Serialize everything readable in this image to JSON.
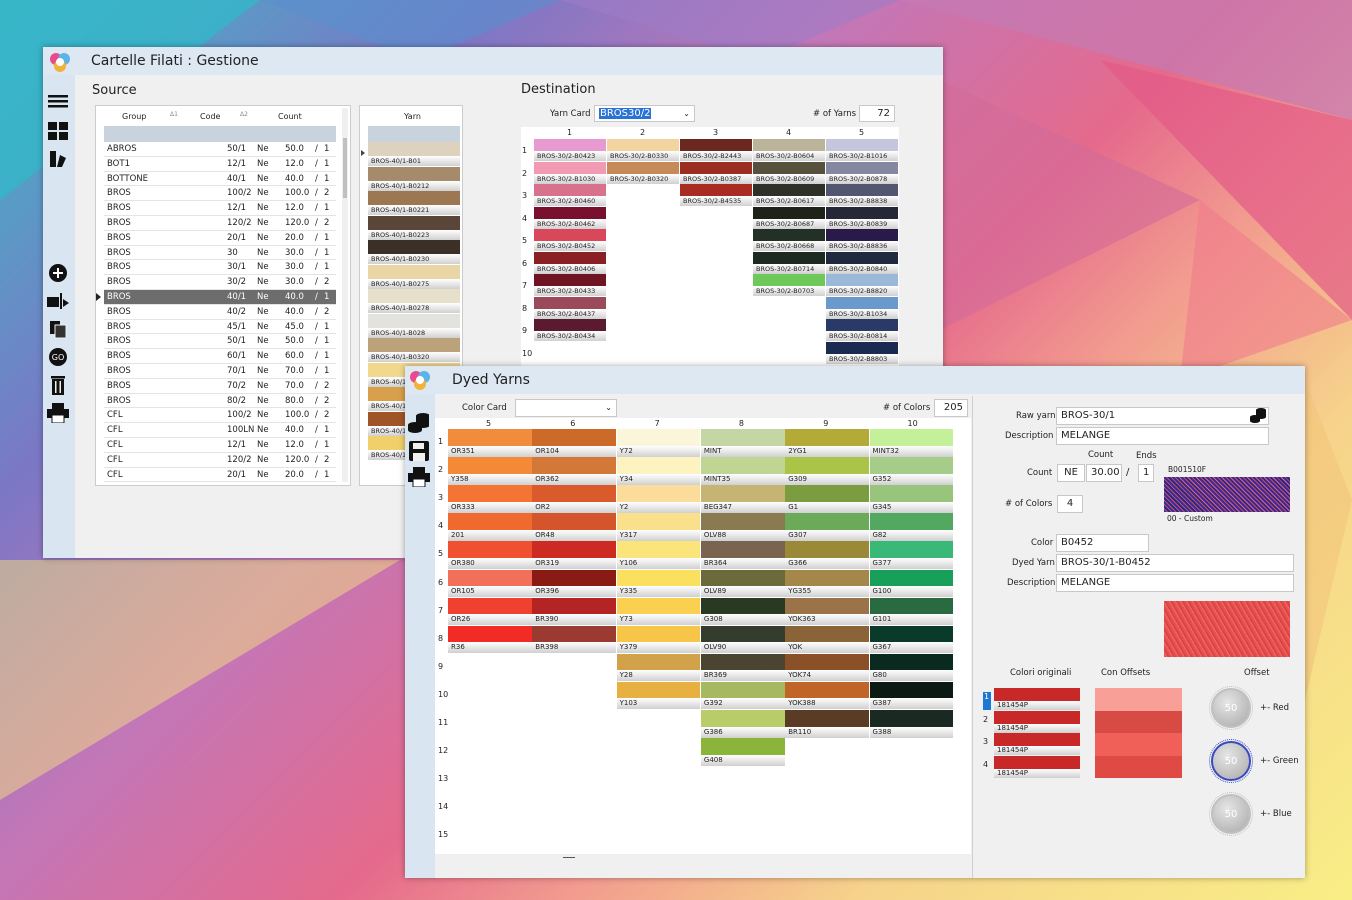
{
  "cartelle": {
    "title": "Cartelle Filati : Gestione",
    "source_label": "Source",
    "destination_label": "Destination",
    "source_headers": {
      "group": "Group",
      "code": "Code",
      "count": "Count",
      "yarn": "Yarn",
      "sort1": "Δ1",
      "sort2": "Δ2"
    },
    "source_rows": [
      [
        "ABROS",
        "50/1",
        "Ne",
        "50.0",
        "/",
        "1"
      ],
      [
        "BOT1",
        "12/1",
        "Ne",
        "12.0",
        "/",
        "1"
      ],
      [
        "BOTTONE",
        "40/1",
        "Ne",
        "40.0",
        "/",
        "1"
      ],
      [
        "BROS",
        "100/2",
        "Ne",
        "100.0",
        "/",
        "2"
      ],
      [
        "BROS",
        "12/1",
        "Ne",
        "12.0",
        "/",
        "1"
      ],
      [
        "BROS",
        "120/2",
        "Ne",
        "120.0",
        "/",
        "2"
      ],
      [
        "BROS",
        "20/1",
        "Ne",
        "20.0",
        "/",
        "1"
      ],
      [
        "BROS",
        "30",
        "Ne",
        "30.0",
        "/",
        "1"
      ],
      [
        "BROS",
        "30/1",
        "Ne",
        "30.0",
        "/",
        "1"
      ],
      [
        "BROS",
        "30/2",
        "Ne",
        "30.0",
        "/",
        "2"
      ],
      [
        "BROS",
        "40/1",
        "Ne",
        "40.0",
        "/",
        "1"
      ],
      [
        "BROS",
        "40/2",
        "Ne",
        "40.0",
        "/",
        "2"
      ],
      [
        "BROS",
        "45/1",
        "Ne",
        "45.0",
        "/",
        "1"
      ],
      [
        "BROS",
        "50/1",
        "Ne",
        "50.0",
        "/",
        "1"
      ],
      [
        "BROS",
        "60/1",
        "Ne",
        "60.0",
        "/",
        "1"
      ],
      [
        "BROS",
        "70/1",
        "Ne",
        "70.0",
        "/",
        "1"
      ],
      [
        "BROS",
        "70/2",
        "Ne",
        "70.0",
        "/",
        "2"
      ],
      [
        "BROS",
        "80/2",
        "Ne",
        "80.0",
        "/",
        "2"
      ],
      [
        "CFL",
        "100/2",
        "Ne",
        "100.0",
        "/",
        "2"
      ],
      [
        "CFL",
        "100LN",
        "Ne",
        "40.0",
        "/",
        "1"
      ],
      [
        "CFL",
        "12/1",
        "Ne",
        "12.0",
        "/",
        "1"
      ],
      [
        "CFL",
        "120/2",
        "Ne",
        "120.0",
        "/",
        "2"
      ],
      [
        "CFL",
        "20/1",
        "Ne",
        "20.0",
        "/",
        "1"
      ]
    ],
    "source_selected": 10,
    "source_yarns": [
      {
        "l": "BROS-40/1-B01",
        "c": "#ddd2bd"
      },
      {
        "l": "BROS-40/1-B0212",
        "c": "#a68a6c"
      },
      {
        "l": "BROS-40/1-B0221",
        "c": "#9c7752"
      },
      {
        "l": "BROS-40/1-B0223",
        "c": "#5a4638"
      },
      {
        "l": "BROS-40/1-B0230",
        "c": "#3a3028"
      },
      {
        "l": "BROS-40/1-B0275",
        "c": "#e9d6a6"
      },
      {
        "l": "BROS-40/1-B0278",
        "c": "#e6dfca"
      },
      {
        "l": "BROS-40/1-B028",
        "c": "#e4e2dc"
      },
      {
        "l": "BROS-40/1-B0320",
        "c": "#bca27a"
      },
      {
        "l": "BROS-40/1",
        "c": "#f1d88d"
      },
      {
        "l": "BROS-40/1",
        "c": "#d8a04a"
      },
      {
        "l": "BROS-40/1",
        "c": "#a05528"
      },
      {
        "l": "BROS-40/1",
        "c": "#f1cf6a"
      }
    ],
    "yarn_card_label": "Yarn Card",
    "yarn_card_value": "BROS30/2",
    "num_yarns_label": "# of Yarns",
    "num_yarns_value": "72",
    "dest_cols": [
      "1",
      "2",
      "3",
      "4",
      "5"
    ],
    "dest_rows": [
      "1",
      "2",
      "3",
      "4",
      "5",
      "6",
      "7",
      "8",
      "9",
      "10"
    ],
    "dest_cells": [
      [
        {
          "l": "BROS-30/2-B0423",
          "c": "#e79ad0"
        },
        {
          "l": "BROS-30/2-B0330",
          "c": "#f1d4a0"
        },
        {
          "l": "BROS-30/2-B2443",
          "c": "#6b2820"
        },
        {
          "l": "BROS-30/2-B0604",
          "c": "#bcb49a"
        },
        {
          "l": "BROS-30/2-B1016",
          "c": "#c5c6dc"
        }
      ],
      [
        {
          "l": "BROS-30/2-B1030",
          "c": "#f29ab3"
        },
        {
          "l": "BROS-30/2-B0320",
          "c": "#c68a58"
        },
        {
          "l": "BROS-30/2-B0387",
          "c": "#9b2e20"
        },
        {
          "l": "BROS-30/2-B0609",
          "c": "#57503c"
        },
        {
          "l": "BROS-30/2-B0878",
          "c": "#8586a0"
        }
      ],
      [
        {
          "l": "BROS-30/2-B0460",
          "c": "#d8728c"
        },
        null,
        {
          "l": "BROS-30/2-B4535",
          "c": "#a82c22"
        },
        {
          "l": "BROS-30/2-B0617",
          "c": "#2f3028"
        },
        {
          "l": "BROS-30/2-B8838",
          "c": "#535670"
        }
      ],
      [
        {
          "l": "BROS-30/2-B0462",
          "c": "#7a1030"
        },
        null,
        null,
        {
          "l": "BROS-30/2-B0687",
          "c": "#1e2219"
        },
        {
          "l": "BROS-30/2-B0839",
          "c": "#262838"
        }
      ],
      [
        {
          "l": "BROS-30/2-B0452",
          "c": "#d8485a"
        },
        null,
        null,
        {
          "l": "BROS-30/2-B0668",
          "c": "#223025"
        },
        {
          "l": "BROS-30/2-B8836",
          "c": "#2a1a4a"
        }
      ],
      [
        {
          "l": "BROS-30/2-B0406",
          "c": "#8a2024"
        },
        null,
        null,
        {
          "l": "BROS-30/2-B0714",
          "c": "#1c2a22"
        },
        {
          "l": "BROS-30/2-B0840",
          "c": "#1f2a40"
        }
      ],
      [
        {
          "l": "BROS-30/2-B0433",
          "c": "#6e1422"
        },
        null,
        null,
        {
          "l": "BROS-30/2-B0703",
          "c": "#6fc85a"
        },
        {
          "l": "BROS-30/2-B8820",
          "c": "#9ab8d8"
        }
      ],
      [
        {
          "l": "BROS-30/2-B0437",
          "c": "#9a4a5a"
        },
        null,
        null,
        null,
        {
          "l": "BROS-30/2-B1034",
          "c": "#6a9acc"
        }
      ],
      [
        {
          "l": "BROS-30/2-B0434",
          "c": "#5a1a30"
        },
        null,
        null,
        null,
        {
          "l": "BROS-30/2-B0814",
          "c": "#2a3a68"
        }
      ],
      [
        null,
        null,
        null,
        null,
        {
          "l": "BROS-30/2-B8803",
          "c": "#1a2a50"
        }
      ]
    ]
  },
  "dyed": {
    "title": "Dyed Yarns",
    "color_card_label": "Color Card",
    "color_card_value": "",
    "num_colors_label": "# of Colors",
    "num_colors_value": "205",
    "cols": [
      "5",
      "6",
      "7",
      "8",
      "9",
      "10"
    ],
    "rows": [
      "1",
      "2",
      "3",
      "4",
      "5",
      "6",
      "7",
      "8",
      "9",
      "10",
      "11",
      "12",
      "13",
      "14",
      "15"
    ],
    "cells": [
      [
        {
          "l": "OR351",
          "c": "#f08c3c"
        },
        {
          "l": "OR104",
          "c": "#cc6a2a"
        },
        {
          "l": "Y72",
          "c": "#fbf6da"
        },
        {
          "l": "MINT",
          "c": "#c4d6a4"
        },
        {
          "l": "2YG1",
          "c": "#b4aa38"
        },
        {
          "l": "MINT32",
          "c": "#c4f09a"
        }
      ],
      [
        {
          "l": "Y358",
          "c": "#f48a38"
        },
        {
          "l": "OR362",
          "c": "#d4783a"
        },
        {
          "l": "Y34",
          "c": "#fcf3c0"
        },
        {
          "l": "MINT35",
          "c": "#c0d494"
        },
        {
          "l": "G309",
          "c": "#aac448"
        },
        {
          "l": "G352",
          "c": "#a6cc8a"
        }
      ],
      [
        {
          "l": "OR333",
          "c": "#f47434"
        },
        {
          "l": "OR2",
          "c": "#da5a2c"
        },
        {
          "l": "Y2",
          "c": "#fbdc9a"
        },
        {
          "l": "BEG347",
          "c": "#c6b474"
        },
        {
          "l": "G1",
          "c": "#7c9c40"
        },
        {
          "l": "G345",
          "c": "#98c47c"
        }
      ],
      [
        {
          "l": "201",
          "c": "#f06a30"
        },
        {
          "l": "OR48",
          "c": "#d4552c"
        },
        {
          "l": "Y317",
          "c": "#fbe08c"
        },
        {
          "l": "OLV88",
          "c": "#8a7a52"
        },
        {
          "l": "G307",
          "c": "#6aaa58"
        },
        {
          "l": "G82",
          "c": "#52a860"
        }
      ],
      [
        {
          "l": "OR380",
          "c": "#f05030"
        },
        {
          "l": "OR319",
          "c": "#cc2a22"
        },
        {
          "l": "Y106",
          "c": "#fbe47a"
        },
        {
          "l": "BR364",
          "c": "#7a6450"
        },
        {
          "l": "G366",
          "c": "#9a8a38"
        },
        {
          "l": "G377",
          "c": "#3ab878"
        }
      ],
      [
        {
          "l": "OR105",
          "c": "#f2705a"
        },
        {
          "l": "OR396",
          "c": "#8a1a14"
        },
        {
          "l": "Y335",
          "c": "#fbe060"
        },
        {
          "l": "OLV89",
          "c": "#6a6a3a"
        },
        {
          "l": "YG355",
          "c": "#a4884a"
        },
        {
          "l": "G100",
          "c": "#16a05a"
        }
      ],
      [
        {
          "l": "OR26",
          "c": "#f04030"
        },
        {
          "l": "BR390",
          "c": "#b42424"
        },
        {
          "l": "Y73",
          "c": "#fbd050"
        },
        {
          "l": "G308",
          "c": "#2a3a22"
        },
        {
          "l": "YOK363",
          "c": "#9a7448"
        },
        {
          "l": "G101",
          "c": "#2a6a40"
        }
      ],
      [
        {
          "l": "R36",
          "c": "#f22c24"
        },
        {
          "l": "BR398",
          "c": "#9a3a30"
        },
        {
          "l": "Y379",
          "c": "#f7c648"
        },
        {
          "l": "OLV90",
          "c": "#343c2e"
        },
        {
          "l": "YOK",
          "c": "#8a6438"
        },
        {
          "l": "G367",
          "c": "#0a3a2a"
        }
      ],
      [
        null,
        null,
        {
          "l": "Y28",
          "c": "#d2a24a"
        },
        {
          "l": "BR369",
          "c": "#4a4430"
        },
        {
          "l": "YOK74",
          "c": "#8a5028"
        },
        {
          "l": "G80",
          "c": "#0a2a20"
        }
      ],
      [
        null,
        null,
        {
          "l": "Y103",
          "c": "#e8b040"
        },
        {
          "l": "G392",
          "c": "#a6b860"
        },
        {
          "l": "YOK388",
          "c": "#c06428"
        },
        {
          "l": "G387",
          "c": "#0c1a14"
        }
      ],
      [
        null,
        null,
        null,
        {
          "l": "G386",
          "c": "#b8cc6a"
        },
        {
          "l": "BR110",
          "c": "#5a3c24"
        },
        {
          "l": "G388",
          "c": "#1a2a22"
        }
      ],
      [
        null,
        null,
        null,
        {
          "l": "G408",
          "c": "#8ab43a"
        },
        null,
        null
      ],
      [
        null,
        null,
        null,
        null,
        null,
        null
      ],
      [
        null,
        null,
        null,
        null,
        null,
        null
      ],
      [
        null,
        null,
        null,
        null,
        null,
        null
      ]
    ],
    "raw_yarn_label": "Raw yarn",
    "raw_yarn_value": "BROS-30/1",
    "description_label": "Description",
    "description_value": "MELANGE",
    "count_label": "Count",
    "count_header": "Count",
    "ends_header": "Ends",
    "count_unit": "NE",
    "count_value": "30.00",
    "count_sep": "/",
    "ends_value": "1",
    "swatch_code": "B001510F",
    "swatch_caption": "00 - Custom",
    "num_colors2_label": "# of Colors",
    "num_colors2_value": "4",
    "color_label": "Color",
    "color_value": "B0452",
    "dyed_yarn_label": "Dyed Yarn",
    "dyed_yarn_value": "BROS-30/1-B0452",
    "description2_label": "Description",
    "description2_value": "MELANGE",
    "colori_originali_label": "Colori originali",
    "con_offsets_label": "Con Offsets",
    "offset_label": "Offset",
    "originals": [
      {
        "n": "1",
        "code": "181454P",
        "c": "#c82828"
      },
      {
        "n": "2",
        "code": "181454P",
        "c": "#c82828"
      },
      {
        "n": "3",
        "code": "181454P",
        "c": "#c82828"
      },
      {
        "n": "4",
        "code": "181454P",
        "c": "#c82828"
      }
    ],
    "offsets_colors": [
      "#f8a098",
      "#d84a44",
      "#f06058",
      "#e04a44"
    ],
    "knobs": [
      {
        "v": "50",
        "label": "+- Red",
        "ring": "#c0c0c0"
      },
      {
        "v": "50",
        "label": "+- Green",
        "ring": "#3a4ac0"
      },
      {
        "v": "50",
        "label": "+- Blue",
        "ring": "#c0c0c0"
      }
    ]
  }
}
